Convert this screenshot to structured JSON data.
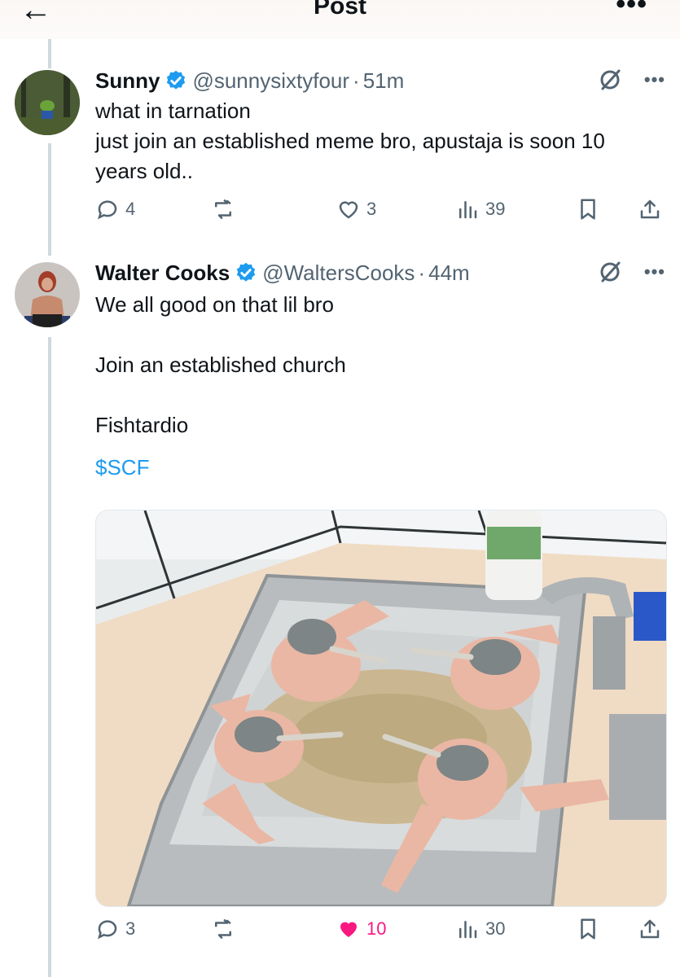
{
  "header": {
    "title": "Post",
    "back_icon": "back-arrow-icon",
    "more_icon": "more-icon"
  },
  "posts": [
    {
      "name": "Sunny",
      "handle": "@sunnysixtyfour",
      "separator": "·",
      "time": "51m",
      "text": "what in tarnation\njust join an established meme bro, apustaja is soon 10\nyears old..",
      "replies": "4",
      "retweets": "",
      "likes": "3",
      "views": "39",
      "liked": false
    },
    {
      "name": "Walter Cooks",
      "handle": "@WaltersCooks",
      "separator": "·",
      "time": "44m",
      "text": "We all good on that lil bro\n\nJoin an established church\n\nFishtardio",
      "cashtag": "$SCF",
      "replies": "3",
      "retweets": "",
      "likes": "10",
      "views": "30",
      "liked": true
    }
  ],
  "colors": {
    "accent": "#1d9bf0",
    "like": "#f91880",
    "muted": "#536471",
    "thread_line": "#cfd9de"
  }
}
